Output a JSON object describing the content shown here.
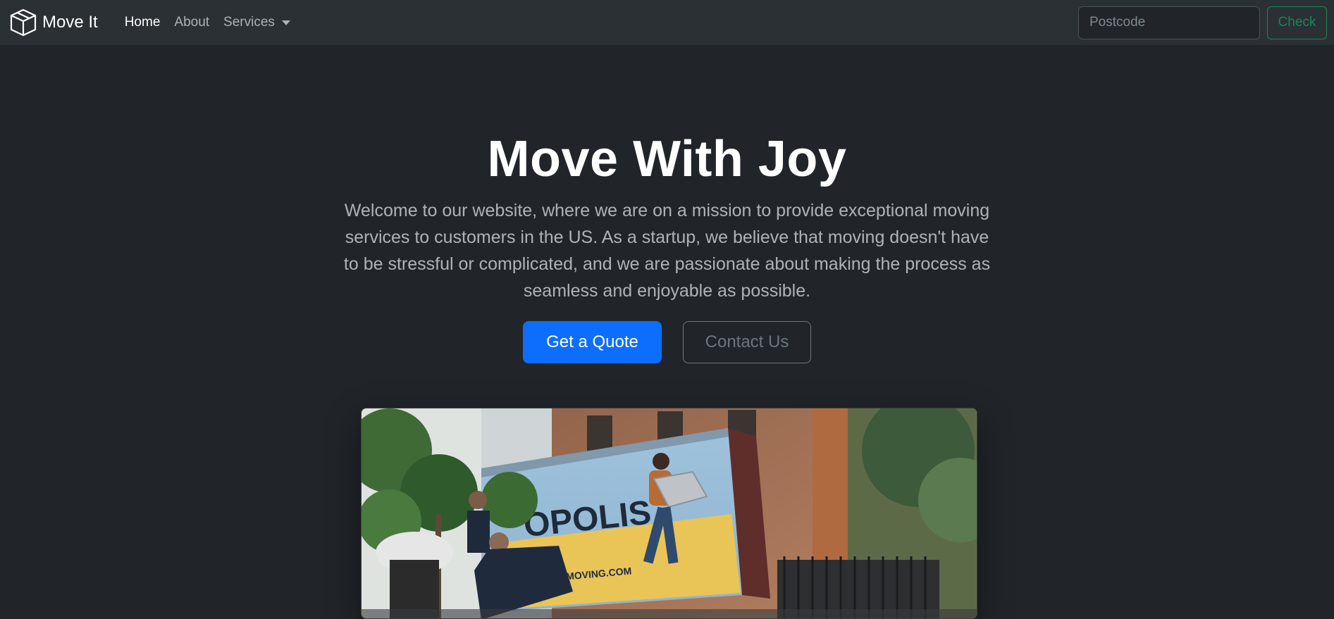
{
  "navbar": {
    "brand": "Move It",
    "links": [
      {
        "label": "Home"
      },
      {
        "label": "About"
      },
      {
        "label": "Services"
      }
    ],
    "postcode_placeholder": "Postcode",
    "check_label": "Check"
  },
  "hero": {
    "title": "Move With Joy",
    "text": "Welcome to our website, where we are on a mission to provide exceptional moving services to customers in the US. As a startup, we believe that moving doesn't have to be stressful or complicated, and we are passionate about making the process as seamless and enjoyable as possible.",
    "primary_button": "Get a Quote",
    "secondary_button": "Contact Us",
    "truck_text_1": "OPOLIS",
    "truck_text_2": "MOVING.COM"
  },
  "colors": {
    "page_bg": "#212529",
    "navbar_bg": "#2b3035",
    "primary": "#0d6efd",
    "success": "#198754",
    "secondary": "#6c757d"
  },
  "icons": {
    "brand": "box-icon",
    "services_dropdown": "caret-down-icon"
  }
}
